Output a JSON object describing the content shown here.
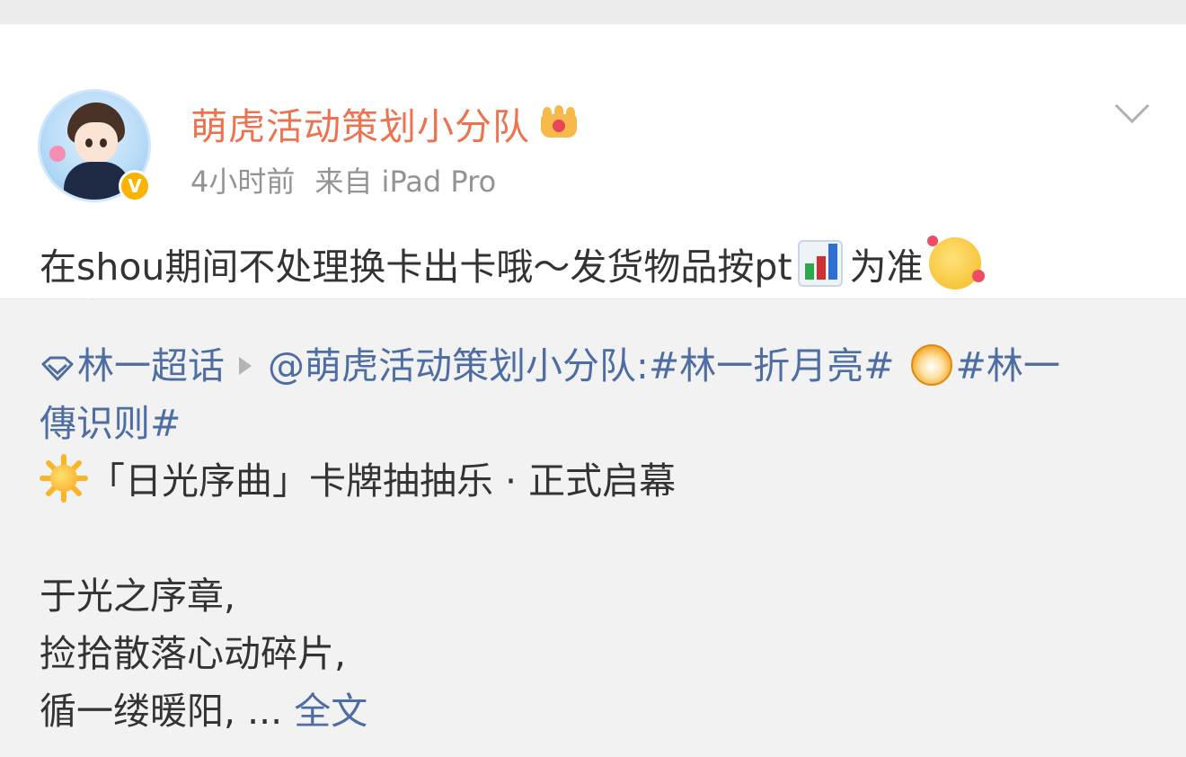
{
  "post": {
    "username": "萌虎活动策划小分队",
    "time": "4小时前",
    "source": "来自 iPad Pro",
    "text_before_chart": "在shou期间不处理换卡出卡哦～发货物品按pt",
    "text_after_chart": "为准",
    "icons": {
      "badge": "verified-v-icon",
      "crown": "crown-icon",
      "chart": "bar-chart-emoji-icon",
      "face": "blushing-face-emoji-icon",
      "menu": "chevron-down-icon"
    },
    "verified_badge_text": "V"
  },
  "repost": {
    "supertopic_label": "林一超话",
    "mention": "@萌虎活动策划小分队:",
    "hashtag1": "#林一折月亮#",
    "hashtag2_part1": "#林一",
    "hashtag2_part2": "傳识则#",
    "line2": "「日光序曲」卡牌抽抽乐 · 正式启幕",
    "poem_line1": "于光之序章,",
    "poem_line2": "捡拾散落心动碎片,",
    "poem_line3": "循一缕暖阳, ...",
    "full_text_link": "全文",
    "icons": {
      "supertopic": "diamond-supertopic-icon",
      "arrow": "play-arrow-icon",
      "tiger": "tiger-emoji-icon",
      "sun": "sun-emoji-icon"
    }
  },
  "colors": {
    "username": "#eb7350",
    "link": "#4e6ea3",
    "meta": "#939393",
    "text": "#333333",
    "repost_bg": "#f2f2f2",
    "badge": "#f9b300"
  }
}
